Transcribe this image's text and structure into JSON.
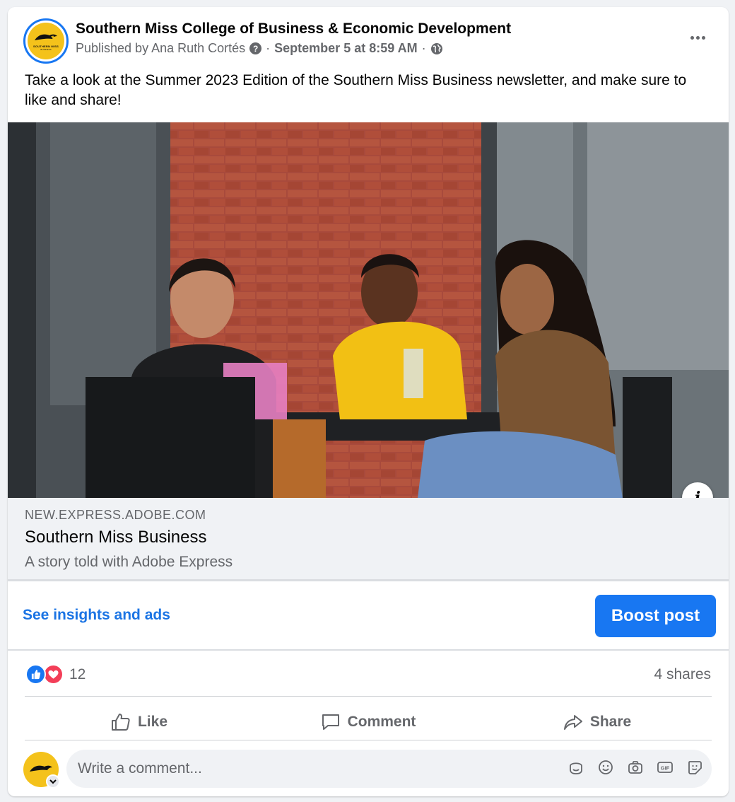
{
  "post": {
    "page_name": "Southern Miss College of Business & Economic Development",
    "published_by": "Published by Ana Ruth Cortés",
    "date": "September 5 at 8:59 AM",
    "separator": "·",
    "text": "Take a look at the Summer 2023 Edition of the Southern Miss Business newsletter, and make sure to like and share!",
    "avatar_text": "SOUTHERN MISS",
    "avatar_sub": "BUSINESS"
  },
  "link_preview": {
    "domain": "NEW.EXPRESS.ADOBE.COM",
    "title": "Southern Miss Business",
    "subtitle": "A story told with Adobe Express",
    "info_label": "i"
  },
  "insights": {
    "link_label": "See insights and ads",
    "boost_label": "Boost post"
  },
  "engagement": {
    "reaction_count": "12",
    "shares": "4 shares"
  },
  "actions": {
    "like": "Like",
    "comment": "Comment",
    "share": "Share"
  },
  "comment": {
    "placeholder": "Write a comment..."
  },
  "colors": {
    "accent": "#1877f2",
    "link": "#1b74e4",
    "love": "#f33e58",
    "brand_gold": "#f4c21b"
  },
  "icons": [
    "question-icon",
    "globe-icon",
    "more-icon",
    "info-icon",
    "like-reaction-icon",
    "love-reaction-icon",
    "thumbs-up-icon",
    "comment-icon",
    "share-icon",
    "avatar-icon",
    "emoji-sticker-icon",
    "smiley-icon",
    "camera-icon",
    "gif-icon",
    "sticker-icon",
    "chevron-down-icon"
  ]
}
